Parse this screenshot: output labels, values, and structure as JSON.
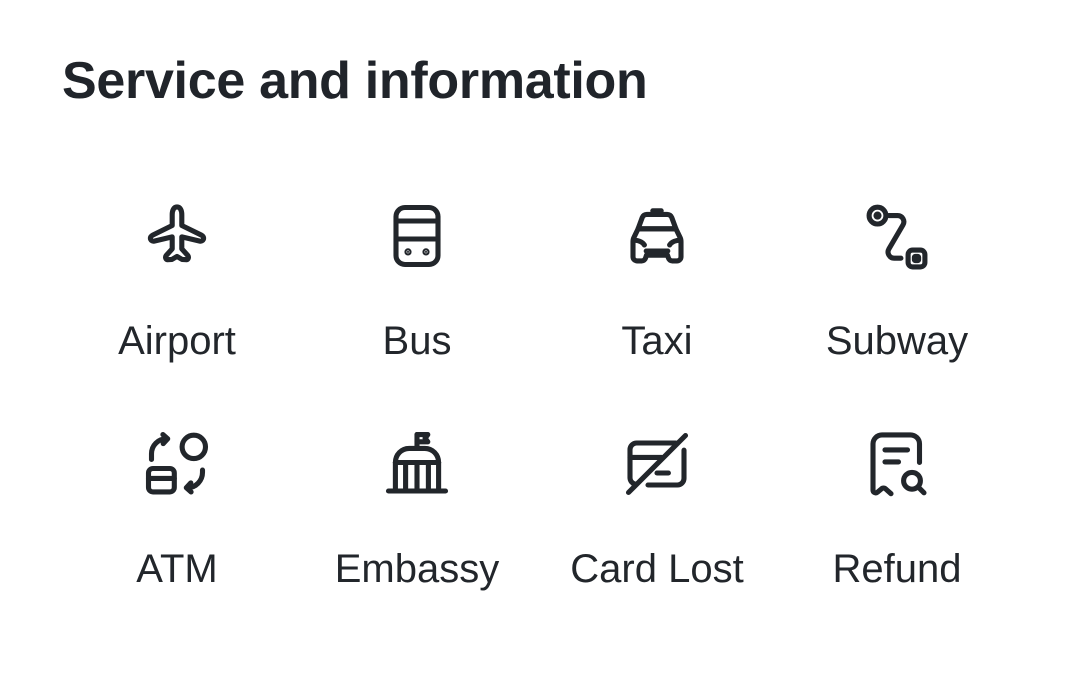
{
  "header": {
    "title": "Service and information"
  },
  "services": [
    {
      "label": "Airport",
      "icon": "airplane-icon"
    },
    {
      "label": "Bus",
      "icon": "bus-icon"
    },
    {
      "label": "Taxi",
      "icon": "taxi-icon"
    },
    {
      "label": "Subway",
      "icon": "route-icon"
    },
    {
      "label": "ATM",
      "icon": "atm-exchange-icon"
    },
    {
      "label": "Embassy",
      "icon": "embassy-building-icon"
    },
    {
      "label": "Card Lost",
      "icon": "card-off-icon"
    },
    {
      "label": "Refund",
      "icon": "receipt-search-icon"
    }
  ],
  "colors": {
    "text": "#22262b",
    "background": "#ffffff"
  }
}
